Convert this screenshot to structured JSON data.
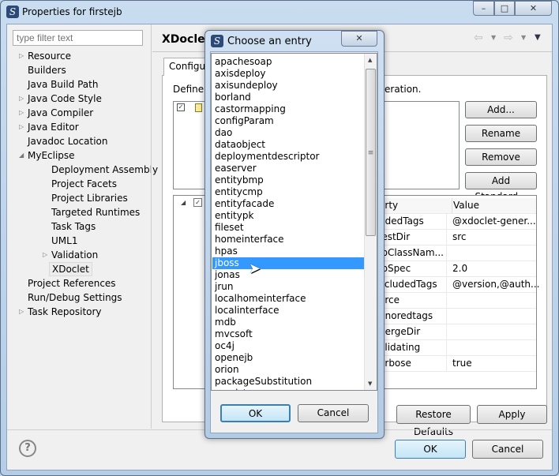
{
  "window": {
    "title": "Properties for firstejb",
    "minimize": "–",
    "maximize": "□",
    "close": "✕"
  },
  "sidebar": {
    "filter_placeholder": "type filter text",
    "items": [
      {
        "label": "Resource",
        "expandable": true,
        "indent": 0
      },
      {
        "label": "Builders",
        "expandable": false,
        "indent": 0
      },
      {
        "label": "Java Build Path",
        "expandable": false,
        "indent": 0
      },
      {
        "label": "Java Code Style",
        "expandable": true,
        "indent": 0
      },
      {
        "label": "Java Compiler",
        "expandable": true,
        "indent": 0
      },
      {
        "label": "Java Editor",
        "expandable": true,
        "indent": 0
      },
      {
        "label": "Javadoc Location",
        "expandable": false,
        "indent": 0
      },
      {
        "label": "MyEclipse",
        "expandable": true,
        "expanded": true,
        "indent": 0
      },
      {
        "label": "Deployment Assembly",
        "expandable": false,
        "indent": 1
      },
      {
        "label": "Project Facets",
        "expandable": false,
        "indent": 1
      },
      {
        "label": "Project Libraries",
        "expandable": false,
        "indent": 1
      },
      {
        "label": "Targeted Runtimes",
        "expandable": false,
        "indent": 1
      },
      {
        "label": "Task Tags",
        "expandable": false,
        "indent": 1
      },
      {
        "label": "UML1",
        "expandable": false,
        "indent": 1
      },
      {
        "label": "Validation",
        "expandable": true,
        "indent": 1
      },
      {
        "label": "XDoclet",
        "expandable": false,
        "indent": 1,
        "selected": true
      },
      {
        "label": "Project References",
        "expandable": false,
        "indent": 0
      },
      {
        "label": "Run/Debug Settings",
        "expandable": false,
        "indent": 0
      },
      {
        "label": "Task Repository",
        "expandable": true,
        "indent": 0
      }
    ]
  },
  "main": {
    "title": "XDoclet",
    "tab": "Configur",
    "define_text_left": "Define t",
    "define_text_right": "eration.",
    "buttons": {
      "add": "Add...",
      "rename": "Rename",
      "remove": "Remove",
      "add_standard": "Add Standard..."
    },
    "table": {
      "headers": [
        "erty",
        "Value"
      ],
      "rows": [
        [
          "ddedTags",
          "@xdoclet-gener..."
        ],
        [
          "lestDir",
          "src"
        ],
        [
          "jbClassNam...",
          ""
        ],
        [
          "jbSpec",
          "2.0"
        ],
        [
          "xcludedTags",
          "@version,@auth..."
        ],
        [
          "orce",
          ""
        ],
        [
          "gnoredtags",
          ""
        ],
        [
          "nergeDir",
          ""
        ],
        [
          "alidating",
          ""
        ],
        [
          "erbose",
          "true"
        ]
      ]
    },
    "restore_defaults": "Restore Defaults",
    "apply": "Apply"
  },
  "footer": {
    "help": "?",
    "ok": "OK",
    "cancel": "Cancel"
  },
  "dialog": {
    "title": "Choose an entry",
    "close": "✕",
    "selected": "jboss",
    "entries": [
      "apachesoap",
      "axisdeploy",
      "axisundeploy",
      "borland",
      "castormapping",
      "configParam",
      "dao",
      "dataobject",
      "deploymentdescriptor",
      "easerver",
      "entitybmp",
      "entitycmp",
      "entityfacade",
      "entitypk",
      "fileset",
      "homeinterface",
      "hpas",
      "jboss",
      "jonas",
      "jrun",
      "localhomeinterface",
      "localinterface",
      "mdb",
      "mvcsoft",
      "oc4j",
      "openejb",
      "orion",
      "packageSubstitution",
      "persistence"
    ],
    "ok": "OK",
    "cancel": "Cancel"
  },
  "colors": {
    "selection": "#3399ff",
    "accent": "#3c7fb1"
  }
}
